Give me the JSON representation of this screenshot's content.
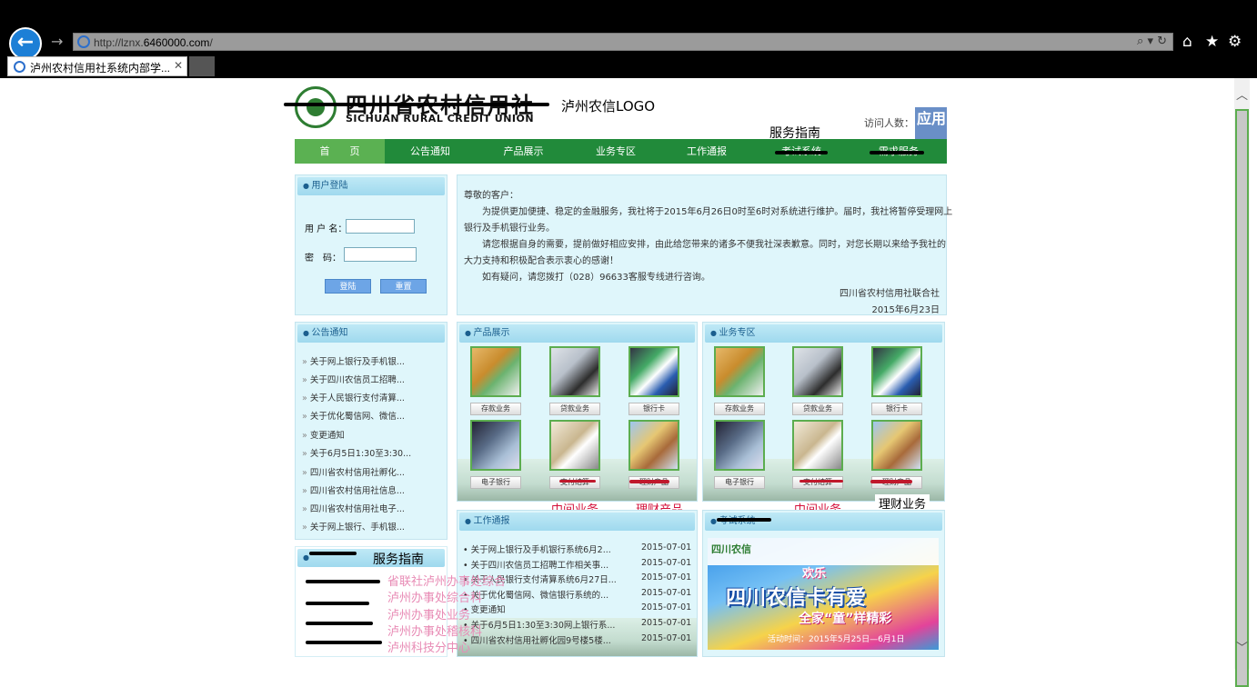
{
  "browser": {
    "url_prefix": "http://lznx.",
    "url_domain": "6460000.com",
    "url_suffix": "/",
    "address_tools": "⌕ ▾ ↻",
    "tab_title": "泸州农村信用社系统内部学...",
    "tab_close": "✕"
  },
  "header": {
    "logo_cn": "四川省农村信用社",
    "logo_en": "SICHUAN RURAL CREDIT UNION",
    "logo_note": "泸州农信LOGO",
    "service_guide": "服务指南",
    "visitors_label": "访问人数：",
    "app_box": "应用"
  },
  "nav": {
    "items": [
      "首　　页",
      "公告通知",
      "产品展示",
      "业务专区",
      "工作通报",
      "考试系统",
      "需求服务"
    ]
  },
  "login": {
    "title": "用户登陆",
    "username_label": "用 户 名：",
    "password_label": "密　码：",
    "login_button": "登陆",
    "reset_button": "重置"
  },
  "notice": {
    "greeting": "尊敬的客户：",
    "line1": "为提供更加便捷、稳定的金融服务，我社将于2015年6月26日0时至6时对系统进行维护。届时，我社将暂停受理网上",
    "line2": "银行及手机银行业务。",
    "line3": "请您根据自身的需要，提前做好相应安排，由此给您带来的诸多不便我社深表歉意。同时，对您长期以来给予我社的",
    "line4": "大力支持和积极配合表示衷心的感谢！",
    "line5": "如有疑问，请您拨打（028）96633客服专线进行咨询。",
    "signature": "四川省农村信用社联合社",
    "date": "2015年6月23日"
  },
  "announcements": {
    "title": "公告通知",
    "items": [
      "关于网上银行及手机银...",
      "关于四川农信员工招聘...",
      "关于人民银行支付清算...",
      "关于优化蜀信网、微信...",
      "变更通知",
      "关于6月5日1:30至3:30...",
      "四川省农村信用社孵化...",
      "四川省农村信用社信息...",
      "四川省农村信用社电子...",
      "关于网上银行、手机银..."
    ]
  },
  "products": {
    "title": "产品展示",
    "captions": [
      "存款业务",
      "贷款业务",
      "银行卡",
      "电子银行",
      "支付结算",
      "理财产品"
    ],
    "red_middle": "中间业务",
    "red_finance": "理财产品"
  },
  "business": {
    "title": "业务专区",
    "captions": [
      "存款业务",
      "贷款业务",
      "银行卡",
      "电子银行",
      "支付结算",
      "理财产品"
    ],
    "red_middle": "中间业务",
    "black_finance": "理财业务"
  },
  "reports": {
    "title": "工作通报",
    "items": [
      {
        "text": "• 关于网上银行及手机银行系统6月2...",
        "date": "2015-07-01"
      },
      {
        "text": "• 关于四川农信员工招聘工作相关事...",
        "date": "2015-07-01"
      },
      {
        "text": "• 关于人民银行支付清算系统6月27日...",
        "date": "2015-07-01"
      },
      {
        "text": "• 关于优化蜀信网、微信银行系统的...",
        "date": "2015-07-01"
      },
      {
        "text": "• 变更通知",
        "date": "2015-07-01"
      },
      {
        "text": "• 关于6月5日1:30至3:30网上银行系...",
        "date": "2015-07-01"
      },
      {
        "text": "• 四川省农村信用社孵化园9号楼5楼...",
        "date": "2015-07-01"
      }
    ]
  },
  "exam": {
    "title": "考试系统"
  },
  "guide": {
    "title_overlay": "服务指南",
    "lines": [
      "省联社泸州办事处综合",
      "泸州办事处综合科",
      "泸州办事处业务",
      "泸州办事处稽核科",
      "泸州科技分中心"
    ]
  },
  "banner": {
    "logo": "四川农信",
    "tag": "欢乐",
    "title": "四川农信卡有爱",
    "subtitle": "全家“童”样精彩",
    "footer": "活动时间：2015年5月25日—6月1日"
  },
  "colors": {
    "nav_green": "#218a3a",
    "nav_active": "#5bb152",
    "panel_bg": "#dff6fb",
    "accent_red": "#d4103a",
    "ie_blue": "#1c7fd6"
  }
}
